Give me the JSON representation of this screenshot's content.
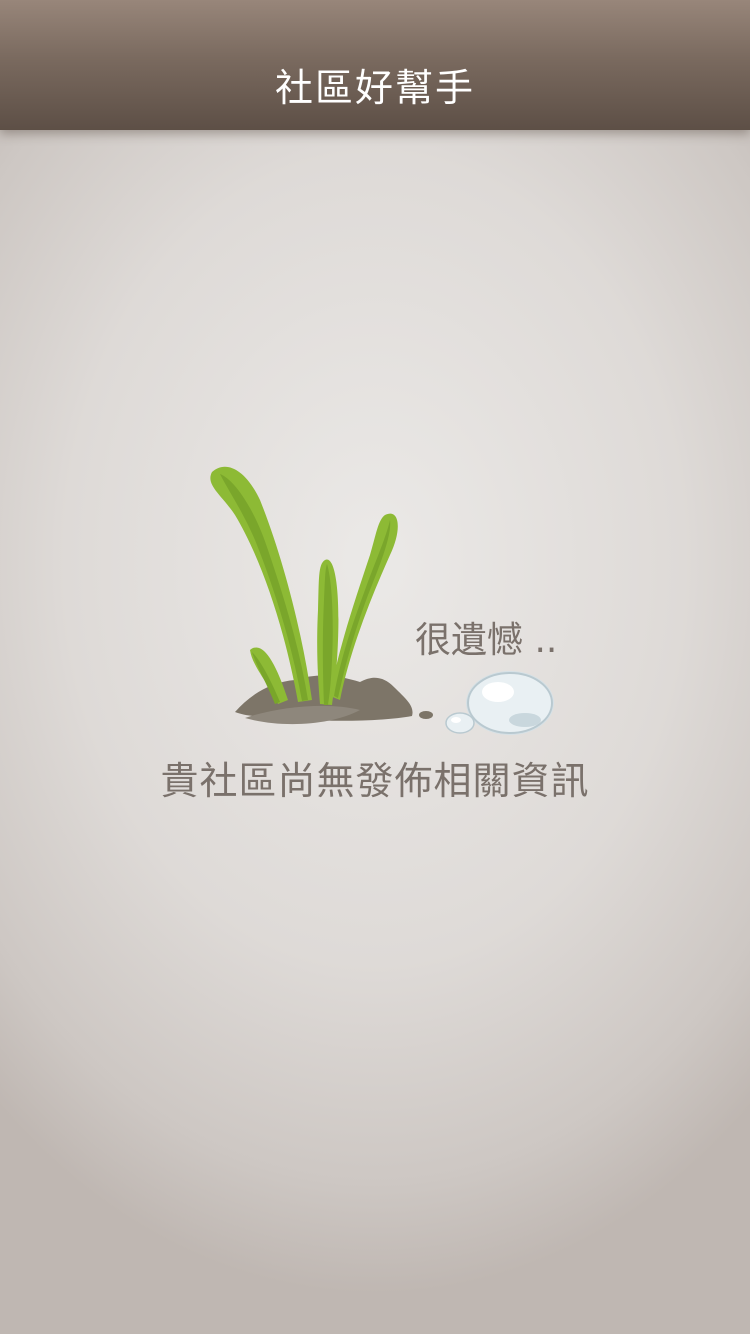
{
  "header": {
    "title": "社區好幫手"
  },
  "empty_state": {
    "sorry_text": "很遺憾 ..",
    "message": "貴社區尚無發佈相關資訊",
    "illustration_icon": "grass-sprout-with-water-drop"
  },
  "colors": {
    "header_top": "#98867a",
    "header_bottom": "#5d4f46",
    "background": "#dedad7",
    "text": "#7a716b",
    "leaf": "#8dba35",
    "soil": "#7d7568"
  }
}
